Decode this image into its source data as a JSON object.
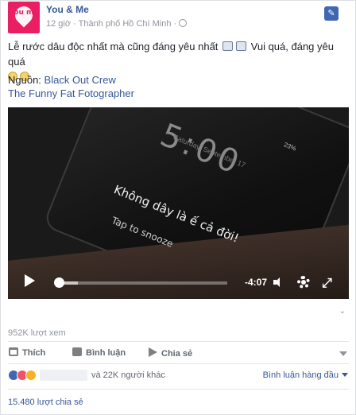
{
  "post": {
    "page_name": "You & Me",
    "avatar_text": "you me",
    "time": "12 giờ",
    "location": "Thành phố Hồ Chí Minh",
    "message_line1": "Lễ rước dâu độc nhất mà cũng đáng yêu nhất",
    "message_mid": "Vui quá, đáng yêu quá",
    "source_label": "Nguồn:",
    "source_link1": "Black Out Crew",
    "source_link2": "The Funny Fat Fotographer"
  },
  "video": {
    "clock": "5:00",
    "date": "Saturday, September 17",
    "battery": "23%",
    "subtitle1": "Không dây là ế cả đời!",
    "subtitle2": "Tap to snooze",
    "time_remaining": "-4:07",
    "progress_fraction": 0.02,
    "buffered_fraction": 0.13
  },
  "stats": {
    "views": "952K lượt xem",
    "reactions_text": "và 22K người khác",
    "comment_sort": "Bình luận hàng đầu",
    "shares": "15.480 lượt chia sẻ"
  },
  "actions": {
    "like": "Thích",
    "comment": "Bình luận",
    "share": "Chia sẻ"
  },
  "icons": [
    "pin-icon",
    "globe-icon",
    "play-icon",
    "volume-icon",
    "gear-icon",
    "fullscreen-icon",
    "like-icon",
    "comment-icon",
    "share-icon",
    "chevron-down-icon"
  ],
  "colors": {
    "brand": "#ea1f63",
    "link": "#365899",
    "fb_blue": "#4267b2"
  }
}
